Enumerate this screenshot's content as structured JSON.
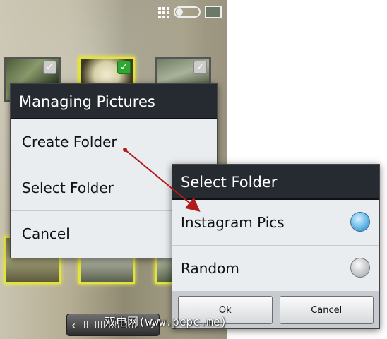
{
  "dialog_managing": {
    "title": "Managing Pictures",
    "items": [
      {
        "label": "Create Folder"
      },
      {
        "label": "Select Folder"
      },
      {
        "label": "Cancel"
      }
    ]
  },
  "dialog_select": {
    "title": "Select Folder",
    "options": [
      {
        "label": "Instagram Pics",
        "selected": true
      },
      {
        "label": "Random",
        "selected": false
      }
    ],
    "buttons": {
      "ok": "Ok",
      "cancel": "Cancel"
    }
  },
  "watermark": "双电网(www.pcpc.me)",
  "colors": {
    "dialog_title_bg": "#252b31",
    "dialog_body_bg": "#eaedf0",
    "selected_thumb_border": "#e3e43a",
    "check_on": "#2ea82e",
    "radio_on": "#67b8e8",
    "arrow": "#b01c1c"
  },
  "icons": [
    "app-grid-icon",
    "toggle-icon",
    "gallery-icon",
    "check-icon",
    "chevron-left-icon",
    "chevron-right-icon"
  ]
}
